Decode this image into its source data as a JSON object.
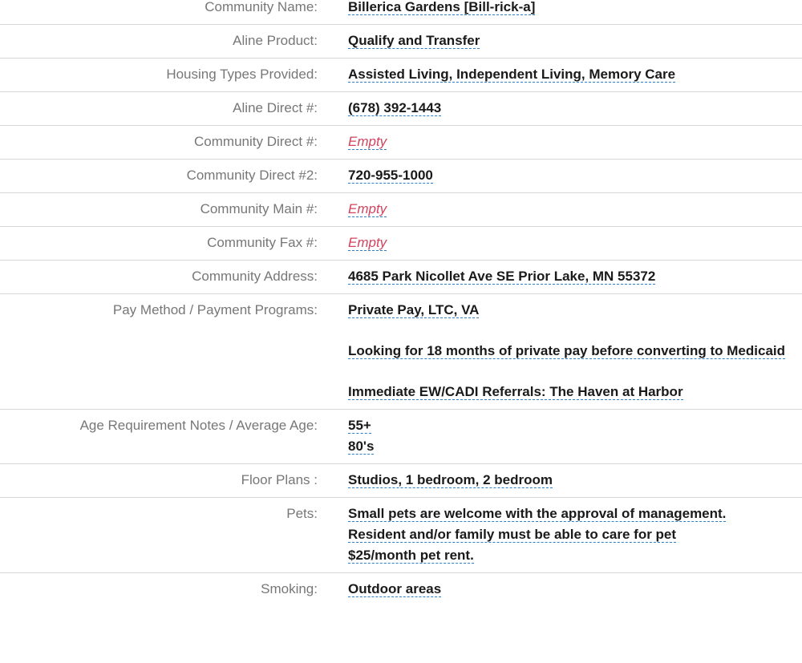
{
  "rows": [
    {
      "label": "Community Name:",
      "value": "Billerica Gardens [Bill-rick-a]"
    },
    {
      "label": "Aline Product:",
      "value": "Qualify and Transfer"
    },
    {
      "label": "Housing Types Provided:",
      "value": "Assisted Living, Independent Living, Memory Care"
    },
    {
      "label": "Aline Direct #:",
      "value": "(678) 392-1443"
    },
    {
      "label": "Community Direct #:",
      "value": "Empty"
    },
    {
      "label": "Community Direct #2:",
      "value": "720-955-1000"
    },
    {
      "label": "Community Main #:",
      "value": "Empty"
    },
    {
      "label": "Community Fax #:",
      "value": "Empty"
    },
    {
      "label": "Community Address:",
      "value": "4685 Park Nicollet Ave SE Prior Lake, MN 55372"
    },
    {
      "label": "Pay Method / Payment Programs:",
      "paragraphs": [
        "Private Pay, LTC, VA",
        "Looking for 18 months of private pay before converting to Medicaid",
        "Immediate EW/CADI Referrals: The Haven at Harbor"
      ]
    },
    {
      "label": "Age Requirement Notes / Average Age:",
      "lines": [
        "55+",
        "80's"
      ]
    },
    {
      "label": "Floor Plans :",
      "value": "Studios, 1 bedroom, 2 bedroom"
    },
    {
      "label": "Pets:",
      "lines": [
        "Small pets are welcome with the approval of management.",
        "Resident and/or family must be able to care for pet",
        "$25/month pet rent."
      ]
    },
    {
      "label": "Smoking:",
      "value": "Outdoor areas"
    }
  ],
  "colors": {
    "label": "#777777",
    "value": "#1a1a1a",
    "empty": "#d4435e",
    "underline": "#2f7fc6",
    "divider": "#d6d6d6"
  }
}
